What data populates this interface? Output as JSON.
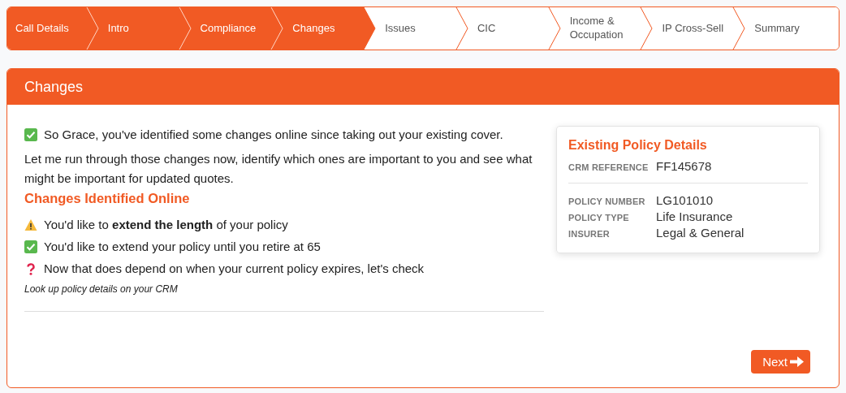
{
  "steps": [
    {
      "label": "Call Details",
      "done": true
    },
    {
      "label": "Intro",
      "done": true
    },
    {
      "label": "Compliance",
      "done": true
    },
    {
      "label": "Changes",
      "done": true
    },
    {
      "label": "Issues",
      "done": false
    },
    {
      "label": "CIC",
      "done": false
    },
    {
      "label": "Income & Occupation",
      "done": false
    },
    {
      "label": "IP Cross-Sell",
      "done": false
    },
    {
      "label": "Summary",
      "done": false
    }
  ],
  "panel": {
    "title": "Changes",
    "intro": {
      "kind": "check",
      "text": "So Grace, you've identified some changes online since taking out your existing cover."
    },
    "paragraph": "Let me run through those changes now, identify which ones are important to you and see what might be important for updated quotes.",
    "section_title": "Changes Identified Online",
    "items": [
      {
        "kind": "warning",
        "text": "You'd like to **extend the length** of your policy"
      },
      {
        "kind": "check",
        "text": "You'd like to extend your policy until you retire at 65"
      },
      {
        "kind": "question",
        "text": "Now that does depend on when your current policy expires, let's check"
      }
    ],
    "note": "Look up policy details on your CRM",
    "card": {
      "title": "Existing Policy Details",
      "groups": [
        [
          {
            "label": "CRM REFERENCE",
            "value": "FF145678"
          }
        ],
        [
          {
            "label": "POLICY NUMBER",
            "value": "LG101010"
          },
          {
            "label": "POLICY TYPE",
            "value": "Life Insurance"
          },
          {
            "label": "INSURER",
            "value": "Legal & General"
          }
        ]
      ]
    },
    "next_button": "Next"
  }
}
